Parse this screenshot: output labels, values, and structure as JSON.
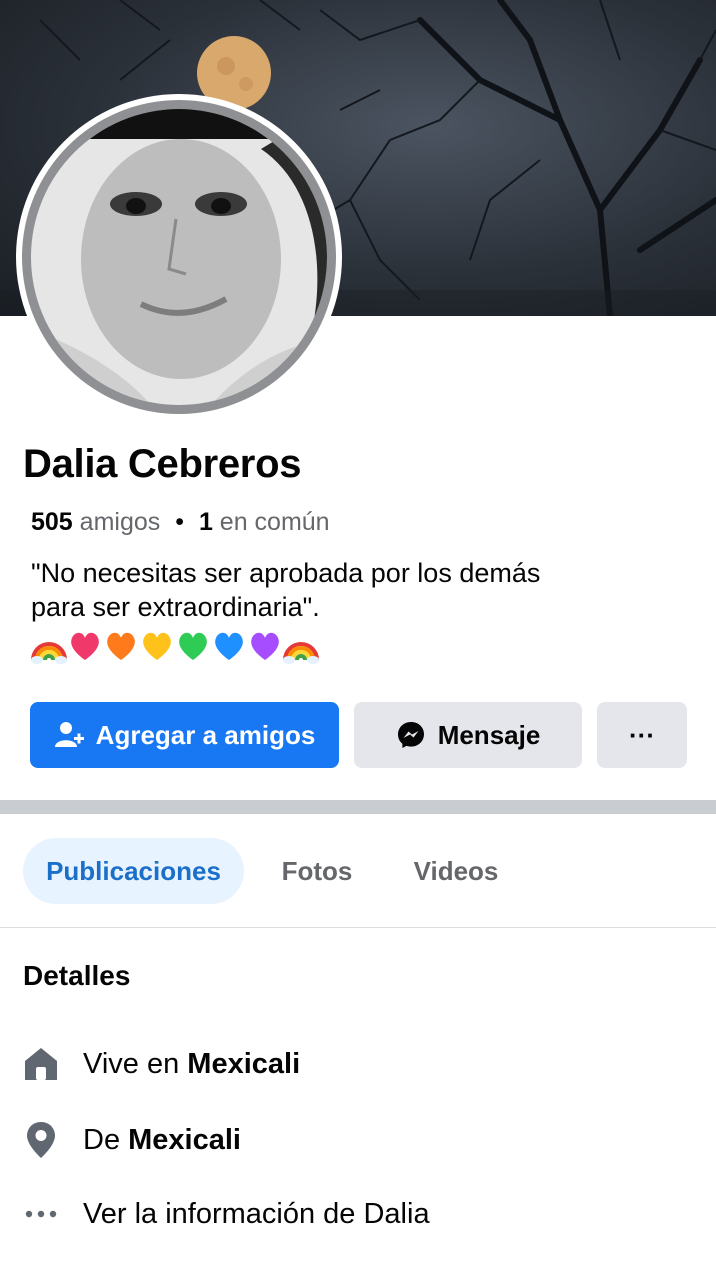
{
  "profile": {
    "name": "Dalia Cebreros",
    "friends_count": "505",
    "friends_label": "amigos",
    "separator": "•",
    "mutual_count": "1",
    "mutual_label": "en común",
    "bio_line1": "\"No necesitas ser aprobada por los demás",
    "bio_line2": "para ser extraordinaria\".",
    "bio_emojis": [
      "rainbow",
      "pink-heart",
      "orange-heart",
      "yellow-heart",
      "green-heart",
      "blue-heart",
      "purple-heart",
      "rainbow"
    ]
  },
  "actions": {
    "add_friend_label": "Agregar a amigos",
    "message_label": "Mensaje",
    "more_label": "···"
  },
  "tabs": [
    {
      "label": "Publicaciones",
      "active": true
    },
    {
      "label": "Fotos",
      "active": false
    },
    {
      "label": "Videos",
      "active": false
    }
  ],
  "details": {
    "title": "Detalles",
    "lives_prefix": "Vive en",
    "lives_city": "Mexicali",
    "from_prefix": "De",
    "from_city": "Mexicali",
    "see_info": "Ver la información de Dalia"
  },
  "colors": {
    "accent": "#1877f2",
    "tab_active_bg": "#e7f3ff",
    "secondary_button": "#e4e6eb"
  },
  "icons": {
    "add_friend": "person-plus-icon",
    "messenger": "messenger-icon",
    "home": "home-icon",
    "location": "location-pin-icon",
    "more": "more-dots-icon"
  }
}
